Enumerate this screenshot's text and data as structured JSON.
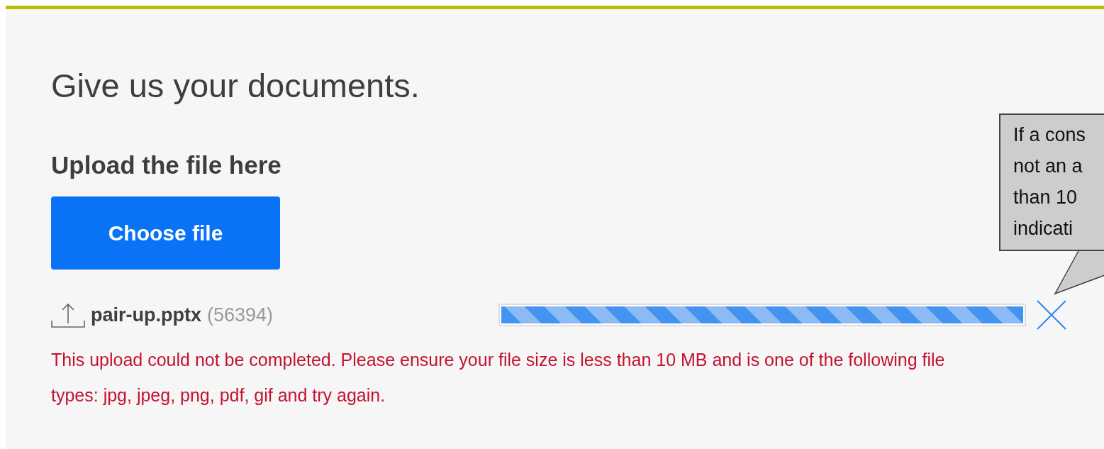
{
  "heading": "Give us your documents.",
  "subheading": "Upload the file here",
  "choose_button": {
    "label": "Choose file"
  },
  "file": {
    "name": "pair-up.pptx",
    "size": "(56394)",
    "level": 1,
    "error": "This upload could not be completed. Please ensure your file size is less than 10 MB and is one of the following file types: jpg, jpeg, png, pdf, gif and try again."
  },
  "callout": {
    "lines": [
      "If a cons",
      "not an a",
      "than 10",
      "indicati"
    ]
  }
}
